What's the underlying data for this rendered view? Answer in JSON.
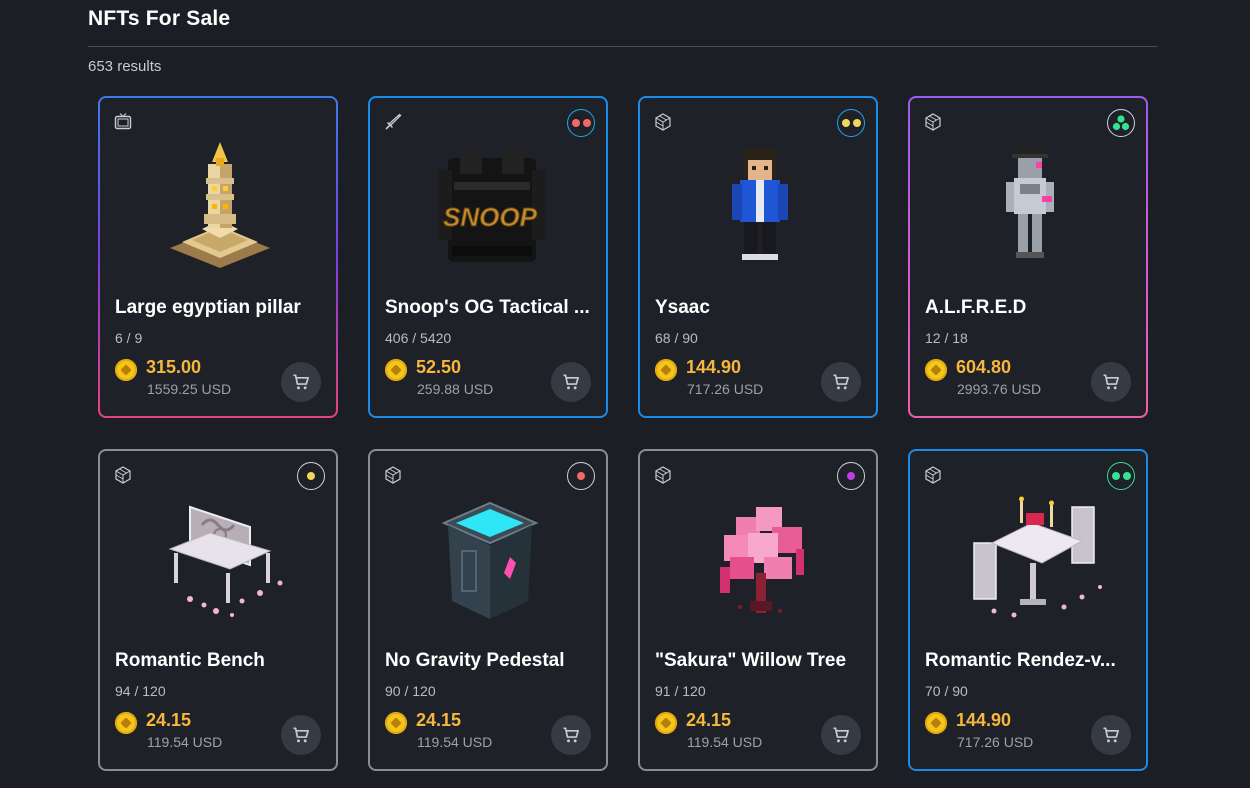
{
  "page": {
    "title": "NFTs For Sale",
    "results_count": "653 results"
  },
  "colors": {
    "price": "#f6b73c",
    "background": "#1b1e24",
    "card_background": "#1e2128"
  },
  "cards": [
    {
      "name": "Large egyptian pillar",
      "edition": "6 / 9",
      "price": "315.00",
      "usd": "1559.25 USD",
      "type_icon": "tv-icon",
      "rarity_dots": [],
      "thumbnail": "egyptian-pillar-image"
    },
    {
      "name": "Snoop's OG Tactical ...",
      "edition": "406 / 5420",
      "price": "52.50",
      "usd": "259.88 USD",
      "type_icon": "sword-icon",
      "rarity_dots": [
        "#f06a6a",
        "#f06a6a"
      ],
      "thumbnail": "snoop-backpack-image"
    },
    {
      "name": "Ysaac",
      "edition": "68 / 90",
      "price": "144.90",
      "usd": "717.26 USD",
      "type_icon": "cube-icon",
      "rarity_dots": [
        "#f2d75a",
        "#f2d75a"
      ],
      "thumbnail": "ysaac-avatar-image"
    },
    {
      "name": "A.L.F.R.E.D",
      "edition": "12 / 18",
      "price": "604.80",
      "usd": "2993.76 USD",
      "type_icon": "cube-icon",
      "rarity_dots": [
        "#35e38e",
        "#35e38e",
        "#35e38e"
      ],
      "thumbnail": "alfred-robot-image"
    },
    {
      "name": "Romantic Bench",
      "edition": "94 / 120",
      "price": "24.15",
      "usd": "119.54 USD",
      "type_icon": "cube-icon",
      "rarity_dots": [
        "#f2d75a"
      ],
      "thumbnail": "romantic-bench-image"
    },
    {
      "name": "No Gravity Pedestal",
      "edition": "90 / 120",
      "price": "24.15",
      "usd": "119.54 USD",
      "type_icon": "cube-icon",
      "rarity_dots": [
        "#f06a6a"
      ],
      "thumbnail": "pedestal-image"
    },
    {
      "name": "\"Sakura\" Willow Tree",
      "edition": "91 / 120",
      "price": "24.15",
      "usd": "119.54 USD",
      "type_icon": "cube-icon",
      "rarity_dots": [
        "#c13ee6"
      ],
      "thumbnail": "sakura-tree-image"
    },
    {
      "name": "Romantic Rendez-v...",
      "edition": "70 / 90",
      "price": "144.90",
      "usd": "717.26 USD",
      "type_icon": "cube-icon",
      "rarity_dots": [
        "#35e38e",
        "#35e38e"
      ],
      "thumbnail": "romantic-table-image"
    }
  ]
}
